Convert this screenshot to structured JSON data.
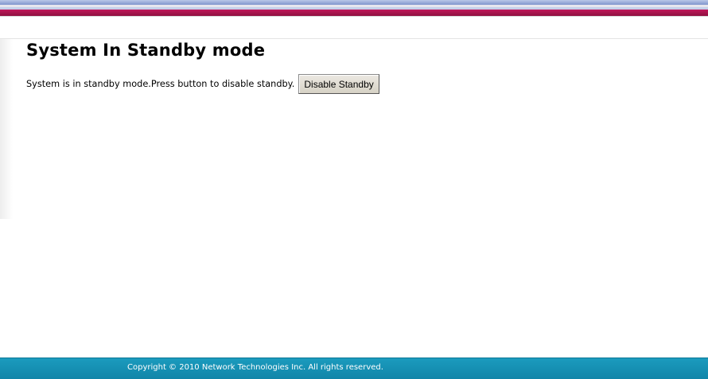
{
  "page": {
    "title": "System In Standby mode",
    "message": "System is in standby mode.Press button to disable standby.",
    "disable_button_label": "Disable Standby"
  },
  "footer": {
    "copyright": "Copyright © 2010 Network Technologies Inc. All rights reserved."
  },
  "colors": {
    "header_red": "#b0154f",
    "header_blue": "#8fa3d4",
    "footer_teal": "#1a95b8"
  }
}
